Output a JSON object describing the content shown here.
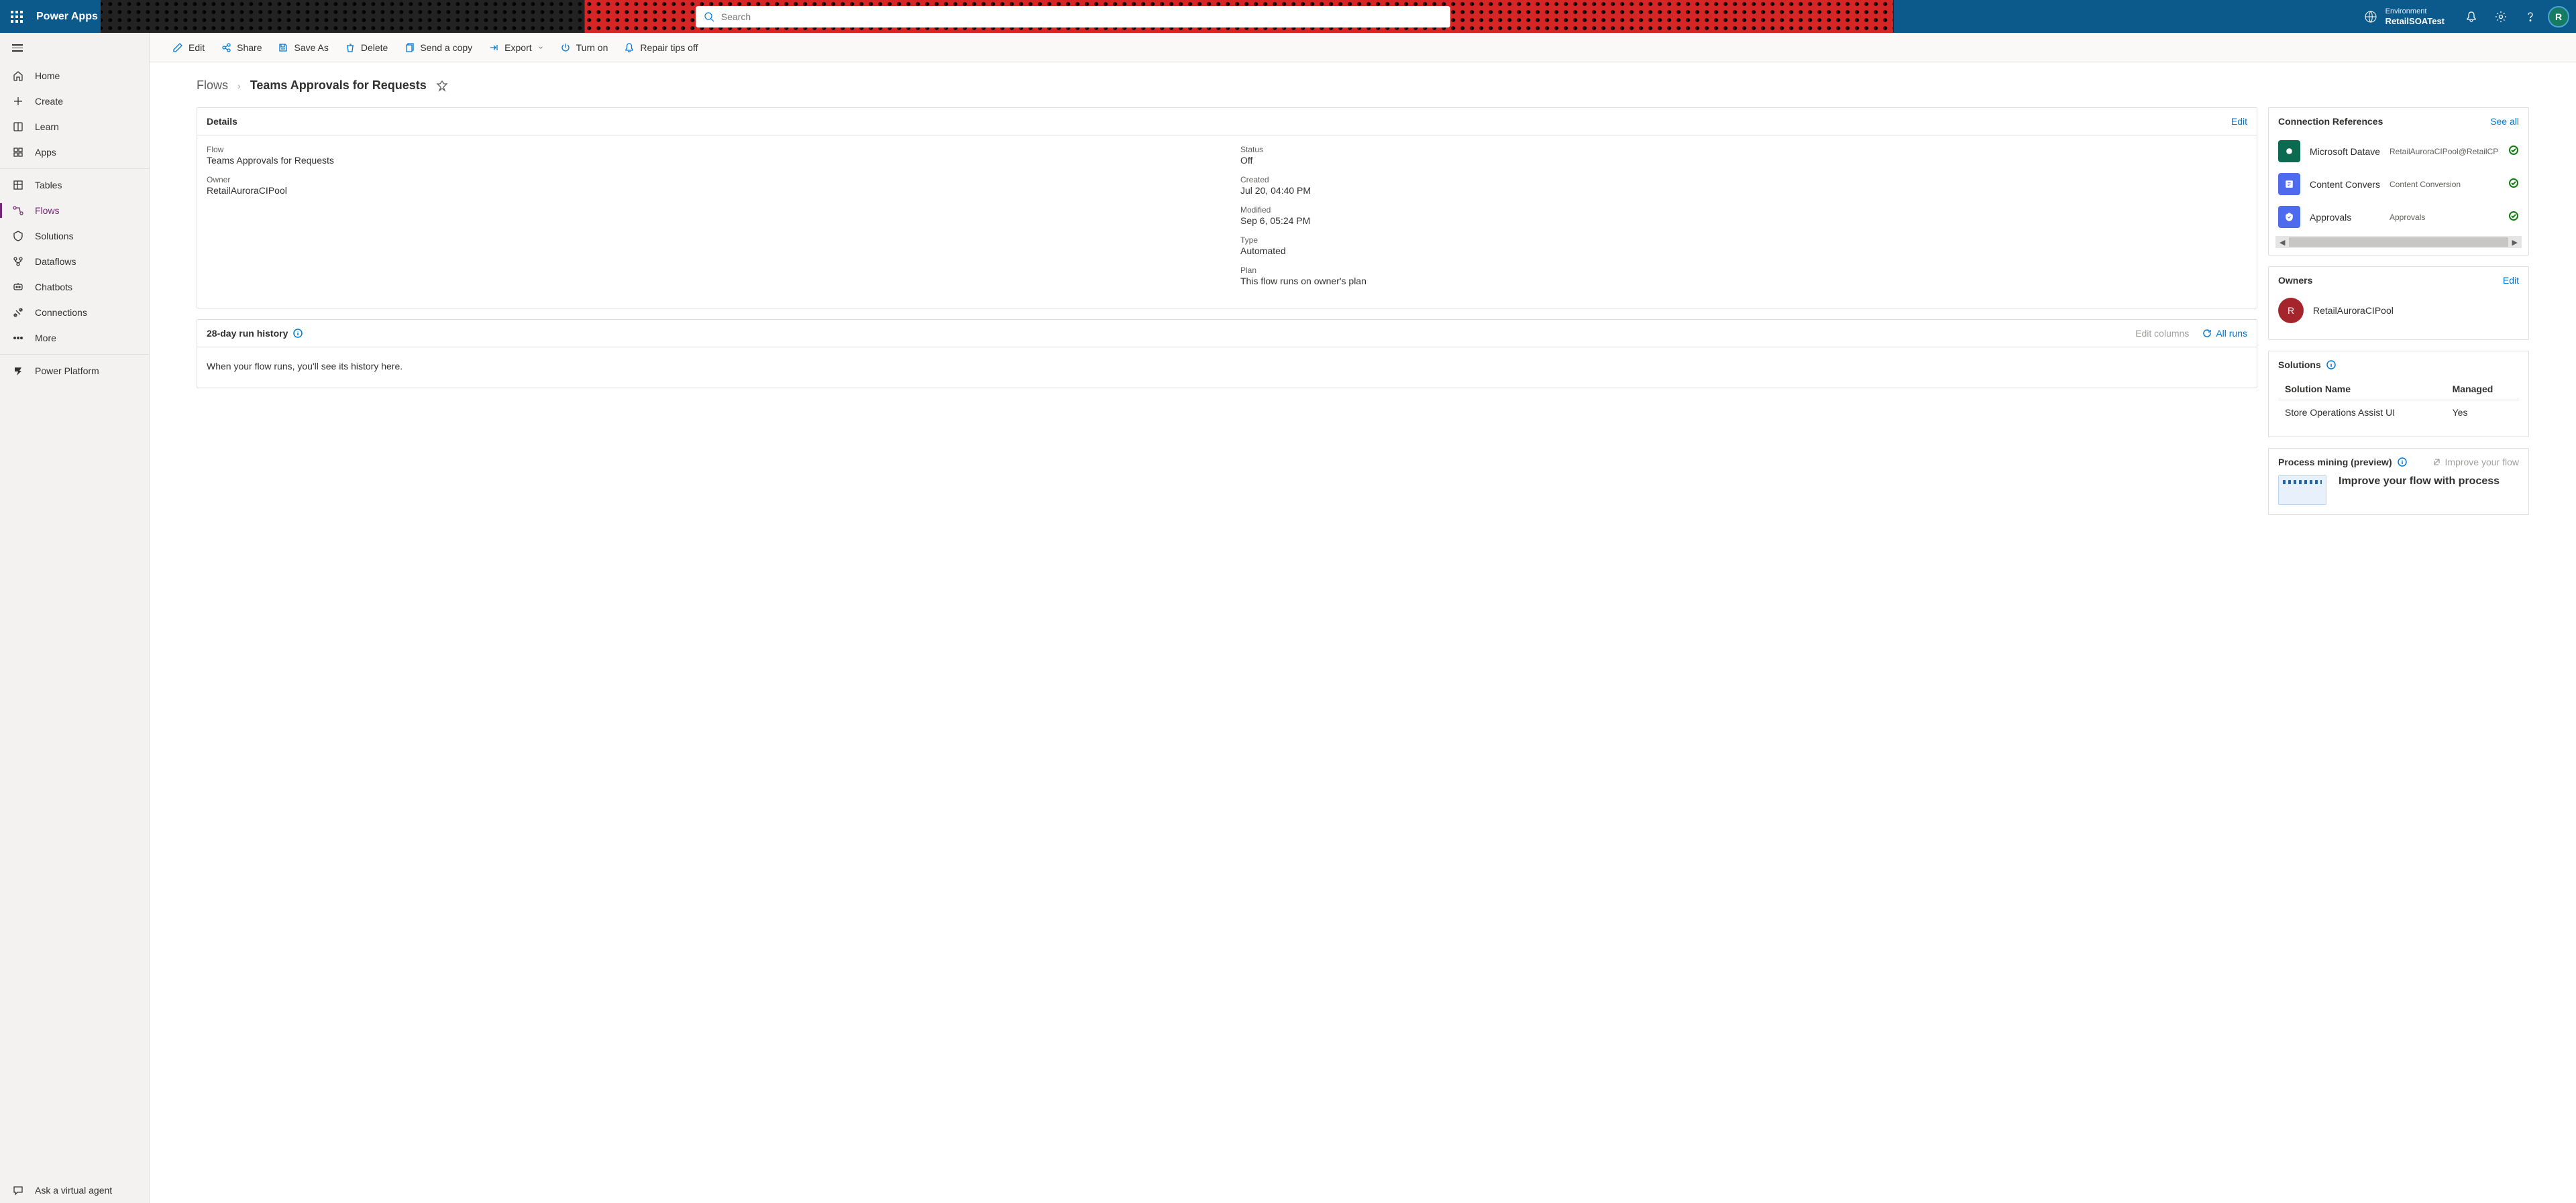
{
  "app_title": "Power Apps",
  "search": {
    "placeholder": "Search"
  },
  "environment": {
    "label": "Environment",
    "name": "RetailSOATest"
  },
  "avatar_initial": "R",
  "sidebar": {
    "items": [
      {
        "label": "Home"
      },
      {
        "label": "Create"
      },
      {
        "label": "Learn"
      },
      {
        "label": "Apps"
      },
      {
        "label": "Tables"
      },
      {
        "label": "Flows"
      },
      {
        "label": "Solutions"
      },
      {
        "label": "Dataflows"
      },
      {
        "label": "Chatbots"
      },
      {
        "label": "Connections"
      },
      {
        "label": "More"
      },
      {
        "label": "Power Platform"
      }
    ],
    "ask_agent": "Ask a virtual agent"
  },
  "commands": {
    "edit": "Edit",
    "share": "Share",
    "save_as": "Save As",
    "delete": "Delete",
    "send_copy": "Send a copy",
    "export": "Export",
    "turn_on": "Turn on",
    "repair_tips": "Repair tips off"
  },
  "breadcrumb": {
    "root": "Flows",
    "current": "Teams Approvals for Requests"
  },
  "details": {
    "title": "Details",
    "edit": "Edit",
    "flow_label": "Flow",
    "flow_value": "Teams Approvals for Requests",
    "owner_label": "Owner",
    "owner_value": "RetailAuroraCIPool",
    "status_label": "Status",
    "status_value": "Off",
    "created_label": "Created",
    "created_value": "Jul 20, 04:40 PM",
    "modified_label": "Modified",
    "modified_value": "Sep 6, 05:24 PM",
    "type_label": "Type",
    "type_value": "Automated",
    "plan_label": "Plan",
    "plan_value": "This flow runs on owner's plan"
  },
  "history": {
    "title": "28-day run history",
    "edit_columns": "Edit columns",
    "all_runs": "All runs",
    "empty_text": "When your flow runs, you'll see its history here."
  },
  "connections": {
    "title": "Connection References",
    "see_all": "See all",
    "items": [
      {
        "name": "Microsoft Dataverse",
        "sub": "RetailAuroraCIPool@RetailCPC",
        "color": "#0b6a4f"
      },
      {
        "name": "Content Conversion",
        "sub": "Content Conversion",
        "color": "#4f6bed"
      },
      {
        "name": "Approvals",
        "sub": "Approvals",
        "color": "#4f6bed"
      }
    ]
  },
  "owners": {
    "title": "Owners",
    "edit": "Edit",
    "items": [
      {
        "initial": "R",
        "name": "RetailAuroraCIPool"
      }
    ]
  },
  "solutions": {
    "title": "Solutions",
    "col_name": "Solution Name",
    "col_managed": "Managed",
    "rows": [
      {
        "name": "Store Operations Assist UI",
        "managed": "Yes"
      }
    ]
  },
  "process_mining": {
    "title": "Process mining (preview)",
    "improve": "Improve your flow",
    "headline": "Improve your flow with process"
  }
}
